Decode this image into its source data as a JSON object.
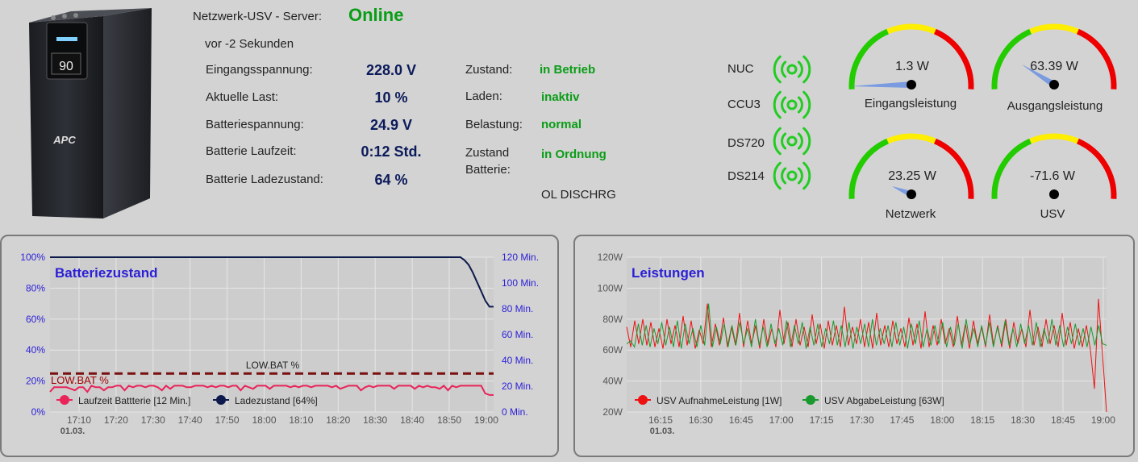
{
  "server": {
    "label": "Netzwerk-USV - Server:",
    "status": "Online",
    "updated": "vor -2 Sekunden"
  },
  "device": {
    "brand": "APC",
    "display": "90"
  },
  "metrics": [
    {
      "label": "Eingangsspannung:",
      "value": "228.0 V"
    },
    {
      "label": "Aktuelle Last:",
      "value": "10 %"
    },
    {
      "label": "Batteriespannung:",
      "value": "24.9 V"
    },
    {
      "label": "Batterie Laufzeit:",
      "value": "0:12 Std."
    },
    {
      "label": "Batterie Ladezustand:",
      "value": "64 %"
    }
  ],
  "states": [
    {
      "label": "Zustand:",
      "value": "in Betrieb"
    },
    {
      "label": "Laden:",
      "value": "inaktiv"
    },
    {
      "label": "Belastung:",
      "value": "normal"
    },
    {
      "label": "Zustand Batterie:",
      "value": "in Ordnung"
    }
  ],
  "status_code": "OL DISCHRG",
  "hosts": [
    {
      "name": "NUC"
    },
    {
      "name": "CCU3"
    },
    {
      "name": "DS720"
    },
    {
      "name": "DS214"
    }
  ],
  "colors": {
    "online": "#0a9d16",
    "signal": "#22cc22",
    "gauge_green": "#22cc00",
    "gauge_yellow": "#ffee00",
    "gauge_red": "#ee0000",
    "needle": "#7a9be0"
  },
  "gauges": [
    {
      "name": "Eingangsleistung",
      "value": "1.3 W"
    },
    {
      "name": "Ausgangsleistung",
      "value": "63.39 W"
    },
    {
      "name": "Netzwerk",
      "value": "23.25 W"
    },
    {
      "name": "USV",
      "value": "-71.6 W"
    }
  ],
  "chart_data": [
    {
      "type": "line",
      "title": "Batteriezustand",
      "y_left_ticks": [
        "100%",
        "80%",
        "60%",
        "40%",
        "20%",
        "0%"
      ],
      "y_right_ticks": [
        "120 Min.",
        "100 Min.",
        "80 Min.",
        "60 Min.",
        "40 Min.",
        "20 Min.",
        "0 Min."
      ],
      "x_ticks": [
        "17:10",
        "17:20",
        "17:30",
        "17:40",
        "17:50",
        "18:00",
        "18:10",
        "18:20",
        "18:30",
        "18:40",
        "18:50",
        "19:00"
      ],
      "x_date": "01.03.",
      "annotation_line": {
        "label": "LOW.BAT %",
        "value": 30
      },
      "series": [
        {
          "name": "Laufzeit Battterie [12 Min.]",
          "color": "#e8245a",
          "values": [
            13,
            16,
            16,
            16,
            16,
            15,
            14,
            16,
            16,
            13,
            17,
            16,
            16,
            14,
            16,
            16,
            17,
            17,
            14,
            17,
            16,
            17,
            17,
            16,
            17,
            17,
            16,
            14,
            17,
            15,
            17,
            17,
            17,
            16,
            16,
            17,
            17,
            17,
            16,
            17,
            16,
            17,
            17,
            16,
            17,
            17,
            14,
            17,
            16,
            15,
            17,
            17,
            17,
            15,
            17,
            17,
            17,
            17,
            16,
            17,
            16,
            17,
            17,
            16,
            17,
            17,
            17,
            17,
            16,
            17,
            15,
            16,
            17,
            17,
            17,
            14,
            16,
            17,
            16,
            17,
            17,
            17,
            17,
            15,
            17,
            17,
            17,
            17,
            15,
            17,
            16,
            17,
            16,
            16,
            15,
            17,
            14,
            17,
            16,
            17,
            17,
            17,
            17,
            17,
            17,
            12,
            11,
            11
          ]
        },
        {
          "name": "Ladezustand [64%]",
          "color": "#0d1a4d",
          "values": [
            100,
            100,
            100,
            100,
            100,
            100,
            100,
            100,
            100,
            100,
            100,
            100,
            100,
            100,
            100,
            100,
            100,
            100,
            100,
            100,
            100,
            100,
            100,
            100,
            100,
            100,
            100,
            100,
            100,
            100,
            100,
            100,
            100,
            100,
            100,
            100,
            100,
            100,
            100,
            100,
            100,
            100,
            100,
            100,
            100,
            100,
            100,
            100,
            100,
            100,
            100,
            100,
            100,
            100,
            100,
            100,
            100,
            100,
            100,
            100,
            100,
            100,
            100,
            100,
            100,
            100,
            100,
            100,
            100,
            100,
            100,
            100,
            100,
            100,
            100,
            100,
            100,
            100,
            100,
            100,
            100,
            100,
            100,
            100,
            100,
            100,
            100,
            100,
            100,
            100,
            100,
            100,
            100,
            100,
            100,
            100,
            100,
            100,
            100,
            100,
            98,
            95,
            90,
            84,
            78,
            72,
            68,
            68
          ]
        }
      ]
    },
    {
      "type": "line",
      "title": "Leistungen",
      "y_ticks": [
        "120W",
        "100W",
        "80W",
        "60W",
        "40W",
        "20W"
      ],
      "ylim": [
        20,
        120
      ],
      "x_ticks": [
        "16:15",
        "16:30",
        "16:45",
        "17:00",
        "17:15",
        "17:30",
        "17:45",
        "18:00",
        "18:15",
        "18:30",
        "18:45",
        "19:00"
      ],
      "x_date": "01.03.",
      "series": [
        {
          "name": "USV AufnahmeLeistung [1W]",
          "color": "#ee1111",
          "values": [
            75,
            62,
            79,
            64,
            80,
            63,
            78,
            62,
            74,
            61,
            80,
            64,
            76,
            62,
            82,
            63,
            79,
            61,
            73,
            64,
            90,
            62,
            77,
            63,
            81,
            62,
            75,
            63,
            84,
            62,
            79,
            64,
            76,
            61,
            80,
            63,
            74,
            62,
            86,
            64,
            78,
            62,
            80,
            63,
            75,
            62,
            83,
            64,
            77,
            61,
            79,
            63,
            76,
            62,
            88,
            63,
            75,
            64,
            80,
            62,
            78,
            61,
            84,
            63,
            76,
            62,
            79,
            64,
            74,
            62,
            81,
            63,
            77,
            61,
            85,
            62,
            76,
            63,
            80,
            64,
            74,
            62,
            82,
            63,
            77,
            61,
            79,
            64,
            75,
            62,
            83,
            63,
            76,
            62,
            80,
            61,
            78,
            64,
            74,
            62,
            86,
            63,
            75,
            62,
            80,
            64,
            76,
            62,
            84,
            63,
            78,
            61,
            74,
            62,
            76,
            60,
            35,
            93,
            57,
            20
          ]
        },
        {
          "name": "USV AbgabeLeistung [63W]",
          "color": "#1a9a2e",
          "values": [
            64,
            66,
            62,
            77,
            63,
            76,
            62,
            74,
            64,
            78,
            63,
            75,
            62,
            79,
            61,
            77,
            64,
            74,
            62,
            76,
            63,
            90,
            62,
            75,
            64,
            77,
            62,
            76,
            63,
            78,
            64,
            74,
            62,
            80,
            63,
            75,
            62,
            77,
            64,
            74,
            63,
            79,
            62,
            76,
            64,
            78,
            61,
            75,
            63,
            77,
            62,
            74,
            64,
            79,
            63,
            76,
            62,
            78,
            61,
            75,
            64,
            77,
            62,
            80,
            63,
            74,
            64,
            76,
            62,
            78,
            63,
            75,
            61,
            77,
            64,
            79,
            62,
            74,
            63,
            76,
            64,
            78,
            62,
            75,
            63,
            77,
            61,
            80,
            64,
            74,
            62,
            76,
            63,
            78,
            62,
            75,
            64,
            79,
            63,
            74,
            62,
            77,
            64,
            76,
            63,
            78,
            62,
            74,
            64,
            80,
            63,
            76,
            62,
            75,
            64,
            77,
            63,
            74,
            62,
            75,
            63,
            76,
            64,
            63
          ]
        }
      ]
    }
  ]
}
